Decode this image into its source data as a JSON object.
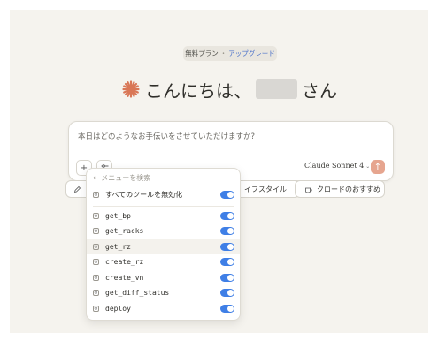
{
  "plan": {
    "free_label": "無料プラン",
    "separator": "・",
    "upgrade_label": "アップグレード"
  },
  "greeting": {
    "text_before": "こんにちは、",
    "text_after": "さん"
  },
  "composer": {
    "placeholder": "本日はどのようなお手伝いをさせていただけますか?",
    "model_label": "Claude Sonnet 4",
    "add_glyph": "+",
    "tools_glyph": "⚙",
    "send_glyph": "↑"
  },
  "chips": {
    "style_label": "イフスタイル",
    "claude_pick_label": "クロードのおすすめ"
  },
  "tool_menu": {
    "back_label": "メニューを検索",
    "disable_all_label": "すべてのツールを無効化",
    "tools": [
      {
        "name": "get_bp",
        "enabled": true
      },
      {
        "name": "get_racks",
        "enabled": true
      },
      {
        "name": "get_rz",
        "enabled": true
      },
      {
        "name": "create_rz",
        "enabled": true
      },
      {
        "name": "create_vn",
        "enabled": true
      },
      {
        "name": "get_diff_status",
        "enabled": true
      },
      {
        "name": "deploy",
        "enabled": true
      }
    ]
  },
  "colors": {
    "accent": "#d97757",
    "toggle_on": "#3f7fe6",
    "link": "#4a71c9",
    "send": "#e6a58f"
  }
}
